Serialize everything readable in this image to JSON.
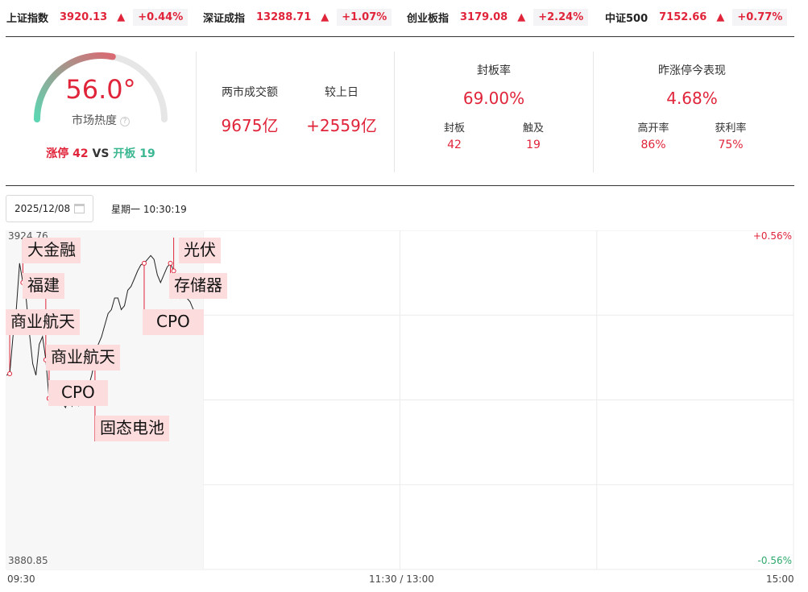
{
  "ticker": [
    {
      "name": "上证指数",
      "price": "3920.13",
      "arrow": "▲",
      "pct": "+0.44%"
    },
    {
      "name": "深证成指",
      "price": "13288.71",
      "arrow": "▲",
      "pct": "+1.07%"
    },
    {
      "name": "创业板指",
      "price": "3179.08",
      "arrow": "▲",
      "pct": "+2.24%"
    },
    {
      "name": "中证500",
      "price": "7152.66",
      "arrow": "▲",
      "pct": "+0.77%"
    }
  ],
  "heat": {
    "value": "56.0°",
    "label": "市场热度",
    "help": "?",
    "level": 0.56,
    "limit_up_label": "涨停",
    "limit_up_count": "42",
    "vs": "VS",
    "opened_label": "开板",
    "opened_count": "19"
  },
  "turnover": {
    "label": "两市成交额",
    "value": "9675亿",
    "diff_label": "较上日",
    "diff_value": "+2559亿"
  },
  "seal": {
    "title": "封板率",
    "value": "69.00%",
    "sealed_label": "封板",
    "sealed_value": "42",
    "touched_label": "触及",
    "touched_value": "19"
  },
  "yesterday": {
    "title": "昨涨停今表现",
    "value": "4.68%",
    "high_open_label": "高开率",
    "high_open_value": "86%",
    "profit_label": "获利率",
    "profit_value": "75%"
  },
  "date": {
    "value": "2025/12/08",
    "weekday_time": "星期一 10:30:19"
  },
  "chart_data": {
    "type": "line",
    "y_max_label": "3924.76",
    "y_min_label": "3880.85",
    "pct_max_label": "+0.56%",
    "pct_min_label": "-0.56%",
    "ylim": [
      3880.85,
      3924.76
    ],
    "x_ticks": [
      "09:30",
      "11:30 / 13:00",
      "15:00"
    ],
    "x_range_minutes": [
      0,
      240
    ],
    "series": [
      {
        "points": [
          [
            0,
            3906.0
          ],
          [
            1,
            3906.2
          ],
          [
            2,
            3911.0
          ],
          [
            3,
            3914.5
          ],
          [
            4,
            3920.5
          ],
          [
            5,
            3918.0
          ],
          [
            6,
            3916.0
          ],
          [
            7,
            3911.5
          ],
          [
            8,
            3907.5
          ],
          [
            9,
            3906.0
          ],
          [
            10,
            3910.0
          ],
          [
            11,
            3911.0
          ],
          [
            12,
            3908.0
          ],
          [
            13,
            3903.0
          ],
          [
            14,
            3903.5
          ],
          [
            15,
            3904.0
          ],
          [
            16,
            3903.0
          ],
          [
            17,
            3902.5
          ],
          [
            18,
            3901.8
          ],
          [
            19,
            3903.0
          ],
          [
            20,
            3902.0
          ],
          [
            21,
            3903.5
          ],
          [
            22,
            3902.0
          ],
          [
            23,
            3904.0
          ],
          [
            24,
            3903.5
          ],
          [
            25,
            3904.5
          ],
          [
            26,
            3906.0
          ],
          [
            27,
            3908.0
          ],
          [
            28,
            3910.0
          ],
          [
            29,
            3911.0
          ],
          [
            30,
            3912.5
          ],
          [
            31,
            3914.0
          ],
          [
            32,
            3914.5
          ],
          [
            33,
            3916.0
          ],
          [
            34,
            3916.0
          ],
          [
            35,
            3914.5
          ],
          [
            36,
            3915.0
          ],
          [
            37,
            3917.0
          ],
          [
            38,
            3917.5
          ],
          [
            39,
            3918.5
          ],
          [
            40,
            3919.5
          ],
          [
            41,
            3920.3
          ],
          [
            42,
            3920.5
          ],
          [
            43,
            3921.0
          ],
          [
            44,
            3921.5
          ],
          [
            45,
            3921.0
          ],
          [
            46,
            3919.0
          ],
          [
            47,
            3918.0
          ],
          [
            48,
            3919.0
          ],
          [
            49,
            3920.0
          ],
          [
            50,
            3920.5
          ],
          [
            51,
            3919.5
          ],
          [
            52,
            3917.5
          ],
          [
            53,
            3916.0
          ],
          [
            54,
            3917.0
          ],
          [
            55,
            3916.0
          ],
          [
            56,
            3915.5
          ],
          [
            57,
            3914.5
          ],
          [
            58,
            3914.0
          ],
          [
            59,
            3913.5
          ],
          [
            60,
            3912.5
          ]
        ]
      }
    ],
    "annotations": [
      {
        "text": "大金融",
        "time": 5
      },
      {
        "text": "福建",
        "time": 12
      },
      {
        "text": "商业航天",
        "time": 1
      },
      {
        "text": "商业航天",
        "time": 13
      },
      {
        "text": "CPO",
        "time": 13
      },
      {
        "text": "固态电池",
        "time": 27
      },
      {
        "text": "光伏",
        "time": 51
      },
      {
        "text": "存储器",
        "time": 50
      },
      {
        "text": "CPO",
        "time": 42
      }
    ]
  }
}
